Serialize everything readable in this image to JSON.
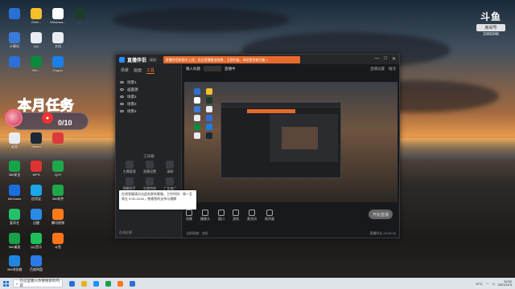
{
  "desktop": {
    "icons": [
      {
        "label": "",
        "color": "#2a6fd6"
      },
      {
        "label": "2345...",
        "color": "#f5c02a"
      },
      {
        "label": "Windows...",
        "color": "#ffffff"
      },
      {
        "label": "...",
        "color": "#1c3b2a"
      },
      {
        "label": "计算机",
        "color": "#3b7ad8"
      },
      {
        "label": "QQ",
        "color": "#e9ecf2"
      },
      {
        "label": "文档",
        "color": "#e9ecf2"
      },
      {
        "label": "",
        "color": "#2d6fd8"
      },
      {
        "label": "360...",
        "color": "#0a8a3c"
      },
      {
        "label": "Kugou",
        "color": "#1a7fe8"
      },
      {
        "label": "桌面",
        "color": "#e9ecf2"
      },
      {
        "label": "Steam",
        "color": "#1b2838"
      },
      {
        "label": "...",
        "color": "#dd3b3b"
      },
      {
        "label": "360安全",
        "color": "#16a34a"
      },
      {
        "label": "WPS",
        "color": "#d33"
      },
      {
        "label": "iQIYI",
        "color": "#1ea84a"
      },
      {
        "label": "WeGame",
        "color": "#1a6fe0"
      },
      {
        "label": "应用宝",
        "color": "#1aa6e8"
      },
      {
        "label": "360软件",
        "color": "#1ea84a"
      },
      {
        "label": "爱奇艺",
        "color": "#25c06a"
      },
      {
        "label": "迅雷",
        "color": "#2a8ae6"
      },
      {
        "label": "腾讯视频",
        "color": "#ff7a1a"
      },
      {
        "label": "360桌面",
        "color": "#19a04a"
      },
      {
        "label": "QQ音乐",
        "color": "#1fbf5b"
      },
      {
        "label": "斗鱼",
        "color": "#ff7518"
      },
      {
        "label": "360浏览器",
        "color": "#1e86e0"
      },
      {
        "label": "百度网盘",
        "color": "#2a7be8"
      }
    ]
  },
  "task": {
    "title": "本月任务",
    "progress": "0/10"
  },
  "brand": {
    "logo": "斗鱼",
    "tag": "房间号",
    "room": "3360348"
  },
  "app": {
    "name": "直播伴侣",
    "version": "2.0",
    "notice": "直播伴侣新版本上线，优化直播推流效果，立即升级，体验更多新功能 >",
    "window_controls": [
      "—",
      "□",
      "✕"
    ],
    "sidebar_tabs": [
      "场景",
      "画面",
      "工具"
    ],
    "scenes": [
      "场景1",
      "画面源",
      "场景2",
      "场景3",
      "场景4"
    ],
    "tools_title": "工具箱",
    "tools": [
      "主播管理",
      "直播设置",
      "录制",
      "弹幕助手",
      "礼物特效",
      "广告推广",
      "房间管理",
      "分享直播",
      "更多工具"
    ],
    "sidebar_bottom": "在线反馈",
    "main_top": [
      "输入标题",
      "直播中"
    ],
    "top_right": [
      "直播设置",
      "推流"
    ],
    "controls": [
      "场景",
      "摄像头",
      "窗口",
      "游戏",
      "麦克风",
      "扬声器"
    ],
    "start_button": "开始直播",
    "status_left": "当前网络：良好",
    "status_right": "直播时长 00:00:00",
    "tooltip": "在线答疑请点击此处联系客服，工作时间：周一至周五 9:00-18:00，感谢您的支持与理解"
  },
  "taskbar": {
    "search_placeholder": "在这里输入你要搜索的内容",
    "tray": {
      "weather": "12°C",
      "time": "10:52",
      "date": "2021/11/3"
    },
    "app_colors": [
      "#2a6fd6",
      "#e7b21a",
      "#1e90ff",
      "#19a04a",
      "#ff7518",
      "#2a6fd6"
    ]
  }
}
